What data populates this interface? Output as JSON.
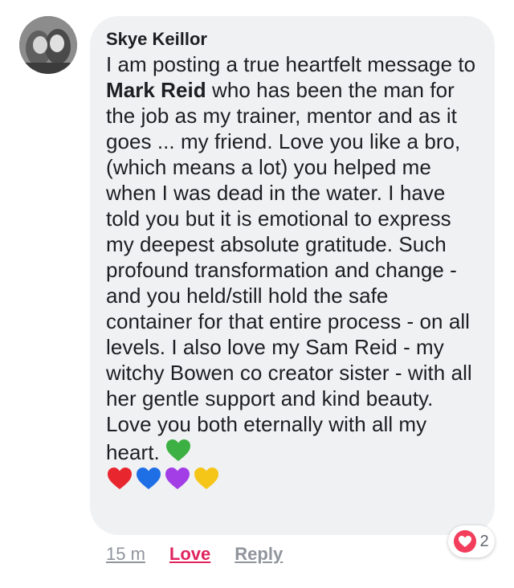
{
  "comment": {
    "author": "Skye Keillor",
    "text_before_mention": "I am posting a true heartfelt message to ",
    "mention": "Mark Reid",
    "text_after_mention": " who has been the man for the job as my trainer, mentor and as it goes ... my friend. Love you like a bro, (which means a lot) you helped me when I was dead in the water. I have told you but it is emotional to express my deepest absolute gratitude. Such profound transformation and change - and you held/still hold the safe container for that entire process - on all levels. I also love my Sam Reid - my witchy Bowen co creator sister - with all her gentle support and kind beauty. Love you both eternally with all my heart.",
    "emojis": [
      "green-heart",
      "red-heart",
      "blue-heart",
      "purple-heart",
      "yellow-heart"
    ]
  },
  "actions": {
    "timestamp": "15 m",
    "love_label": "Love",
    "reply_label": "Reply"
  },
  "reactions": {
    "count": "2",
    "type": "love-icon"
  },
  "colors": {
    "bubble": "#f0f1f3",
    "love": "#e0245e",
    "green_heart": "#3cb043",
    "red_heart": "#e8262d",
    "blue_heart": "#1e6fe6",
    "purple_heart": "#a33ee6",
    "yellow_heart": "#f5c518"
  }
}
